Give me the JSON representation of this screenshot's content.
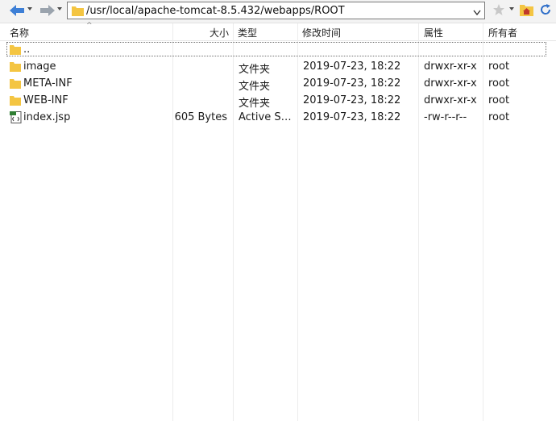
{
  "address": {
    "path": "/usr/local/apache-tomcat-8.5.432/webapps/ROOT"
  },
  "columns": {
    "name": "名称",
    "size": "大小",
    "type": "类型",
    "modified": "修改时间",
    "attributes": "属性",
    "owner": "所有者"
  },
  "files": [
    {
      "name": "..",
      "size": "",
      "type": "",
      "modified": "",
      "attributes": "",
      "owner": "",
      "icon": "folder-icon"
    },
    {
      "name": "image",
      "size": "",
      "type": "文件夹",
      "modified": "2019-07-23, 18:22",
      "attributes": "drwxr-xr-x",
      "owner": "root",
      "icon": "folder-icon"
    },
    {
      "name": "META-INF",
      "size": "",
      "type": "文件夹",
      "modified": "2019-07-23, 18:22",
      "attributes": "drwxr-xr-x",
      "owner": "root",
      "icon": "folder-icon"
    },
    {
      "name": "WEB-INF",
      "size": "",
      "type": "文件夹",
      "modified": "2019-07-23, 18:22",
      "attributes": "drwxr-xr-x",
      "owner": "root",
      "icon": "folder-icon"
    },
    {
      "name": "index.jsp",
      "size": "605 Bytes",
      "type": "Active Ser...",
      "modified": "2019-07-23, 18:22",
      "attributes": "-rw-r--r--",
      "owner": "root",
      "icon": "jsp-file-icon"
    }
  ],
  "colors": {
    "folder": "#f4c542",
    "back_arrow": "#3d7fd6",
    "accent_blue": "#2f6fc9"
  }
}
